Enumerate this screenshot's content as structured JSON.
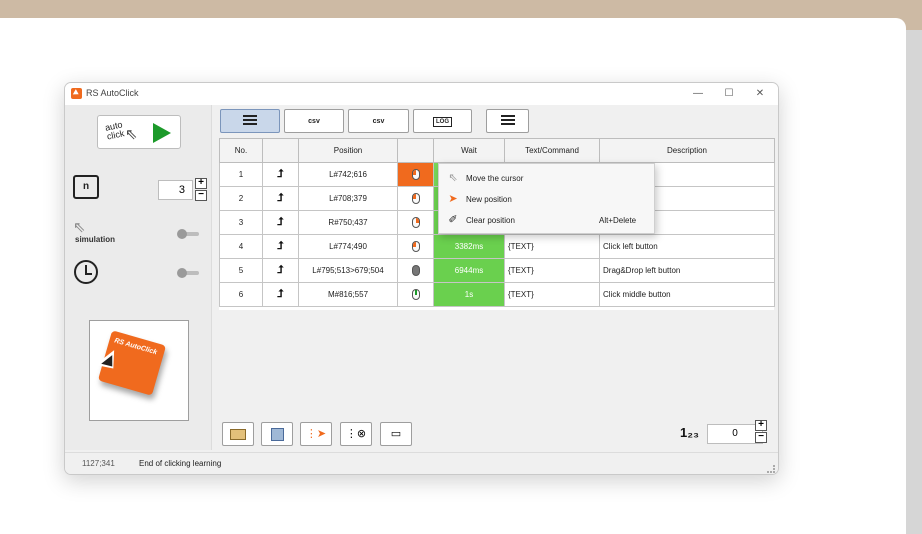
{
  "window": {
    "title": "RS AutoClick",
    "minimize": "—",
    "maximize": "☐",
    "close": "✕"
  },
  "left": {
    "play_label": "auto\nclick",
    "repeat_label": "n",
    "repeat_count": "3",
    "simulation_label": "simulation",
    "logo_text": "RS AutoClick"
  },
  "toolbar": {
    "btn2": "csv",
    "btn3": "csv",
    "btn4": "LOG"
  },
  "table": {
    "headers": [
      "No.",
      "",
      "Position",
      "",
      "Wait",
      "Text/Command",
      "Description"
    ],
    "rows": [
      {
        "no": "1",
        "position": "L#742;616",
        "mouse": "left",
        "wait": "",
        "text": "",
        "desc": "on"
      },
      {
        "no": "2",
        "position": "L#708;379",
        "mouse": "left",
        "wait": "",
        "text": "",
        "desc": "on"
      },
      {
        "no": "3",
        "position": "R#750;437",
        "mouse": "right",
        "wait": "",
        "text": "",
        "desc": "tton"
      },
      {
        "no": "4",
        "position": "L#774;490",
        "mouse": "left",
        "wait": "3382ms",
        "text": "{TEXT}",
        "desc": "Click left button"
      },
      {
        "no": "5",
        "position": "L#795;513>679;504",
        "mouse": "drag",
        "wait": "6944ms",
        "text": "{TEXT}",
        "desc": "Drag&Drop left button"
      },
      {
        "no": "6",
        "position": "M#816;557",
        "mouse": "mid",
        "wait": "1s",
        "text": "{TEXT}",
        "desc": "Click middle button"
      }
    ]
  },
  "context_menu": {
    "items": [
      {
        "label": "Move the cursor",
        "shortcut": ""
      },
      {
        "label": "New position",
        "shortcut": ""
      },
      {
        "label": "Clear position",
        "shortcut": "Alt+Delete"
      }
    ]
  },
  "bottom": {
    "rows_label": "1₂₃",
    "rows_value": "0"
  },
  "status": {
    "coords": "1127;341",
    "message": "End of clicking learning"
  },
  "colors": {
    "accent": "#f06a1e",
    "wait_green": "#6ad04e",
    "play_green": "#1c9a2a"
  }
}
